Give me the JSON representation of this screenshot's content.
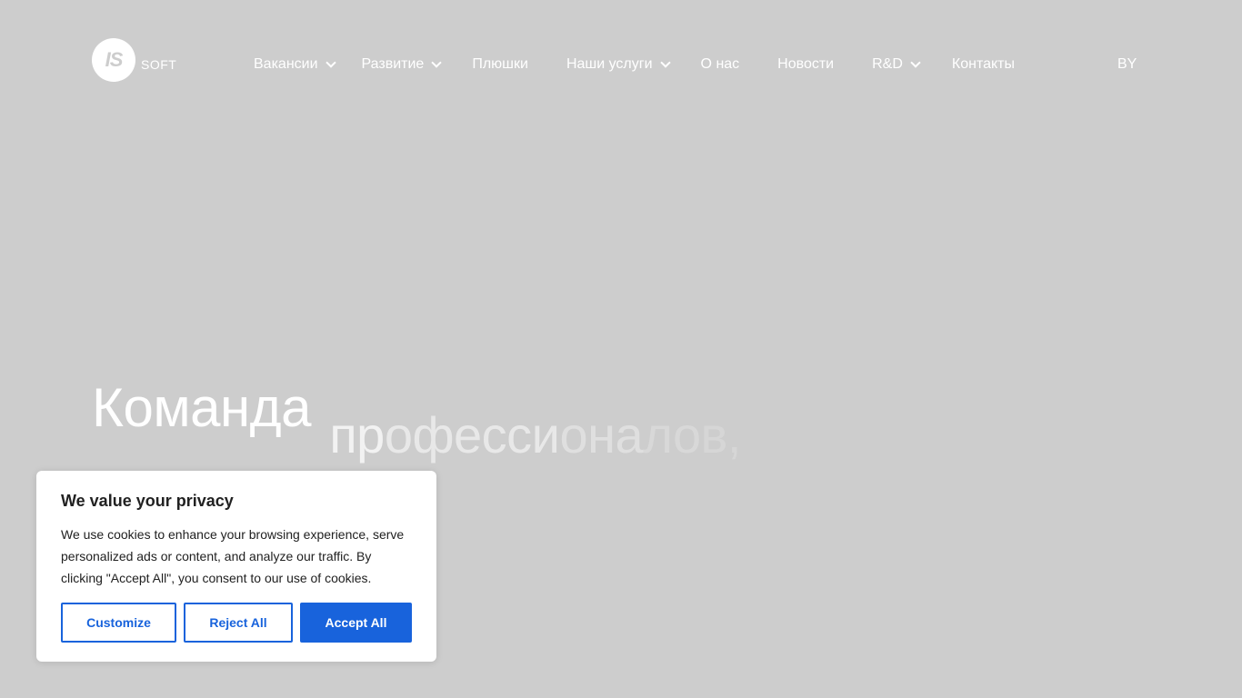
{
  "logo": {
    "mark": "IS",
    "text": "SOFT"
  },
  "nav": {
    "items": [
      {
        "label": "Вакансии",
        "dropdown": true
      },
      {
        "label": "Развитие",
        "dropdown": true
      },
      {
        "label": "Плюшки",
        "dropdown": false
      },
      {
        "label": "Наши услуги",
        "dropdown": true
      },
      {
        "label": "О нас",
        "dropdown": false
      },
      {
        "label": "Новости",
        "dropdown": false
      },
      {
        "label": "R&D",
        "dropdown": true
      },
      {
        "label": "Контакты",
        "dropdown": false
      }
    ],
    "dropdown_icon": "chevron-down-icon"
  },
  "language": "BY",
  "hero": {
    "word1": "Команда",
    "word2_parts": [
      "пр",
      "офесси",
      "она",
      "ло",
      "в,"
    ]
  },
  "cookie_banner": {
    "title": "We value your privacy",
    "text": "We use cookies to enhance your browsing experience, serve personalized ads or content, and analyze our traffic. By clicking \"Accept All\", you consent to our use of cookies.",
    "customize_label": "Customize",
    "reject_label": "Reject All",
    "accept_label": "Accept All"
  },
  "colors": {
    "background": "#cdcdcd",
    "accent": "#1863dc",
    "text_dark": "#212121",
    "white": "#ffffff"
  }
}
